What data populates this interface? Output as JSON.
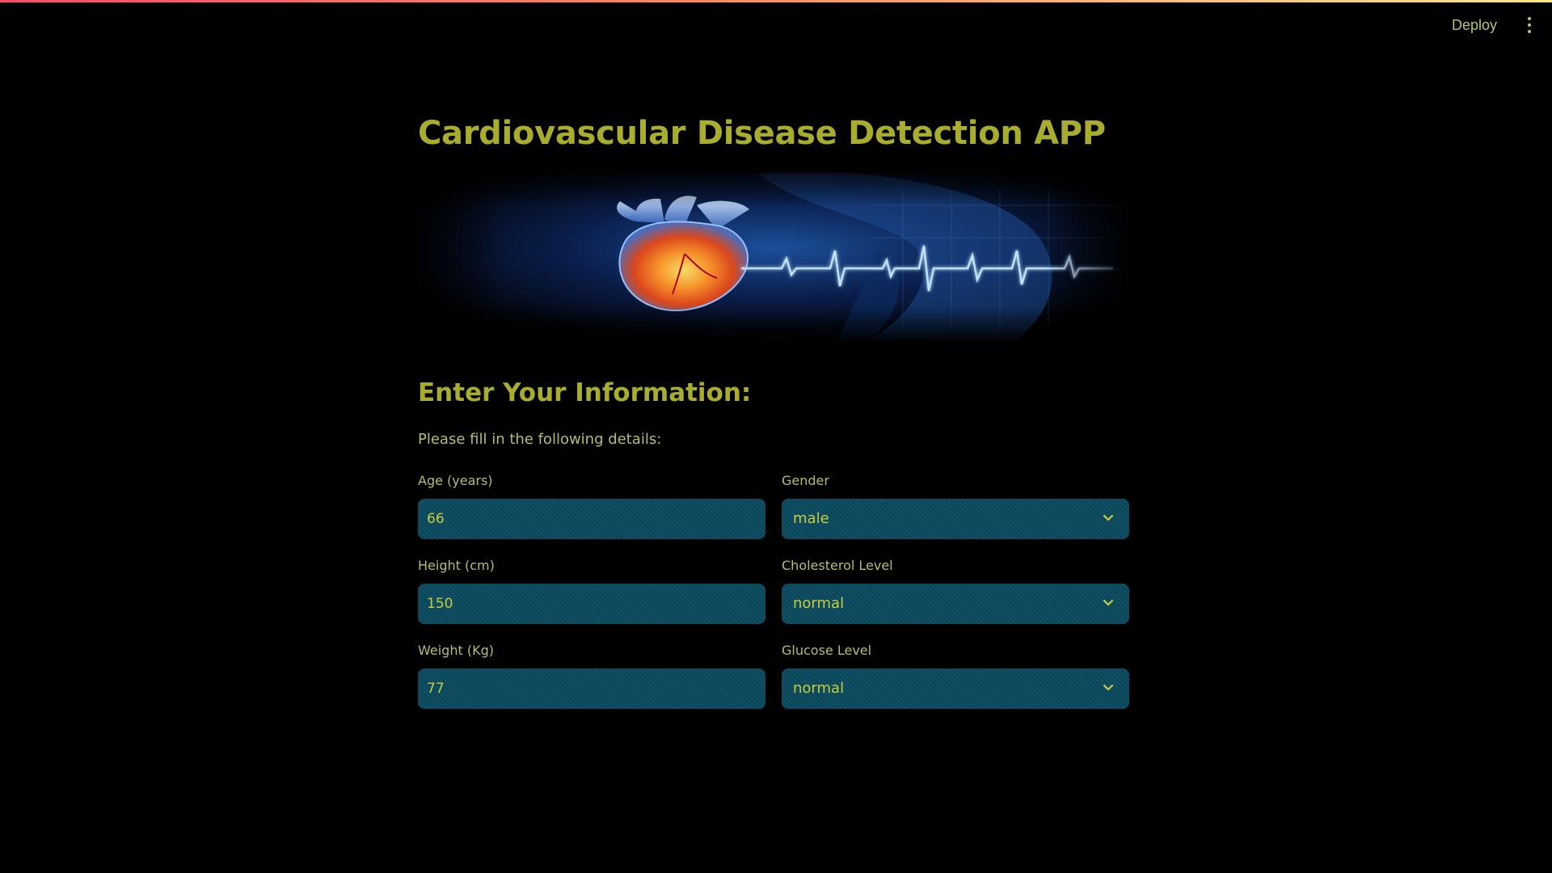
{
  "header": {
    "deploy_label": "Deploy",
    "menu_icon": "kebab-menu-icon"
  },
  "app": {
    "title": "Cardiovascular Disease Detection APP",
    "banner_image": "heart-ekg-banner",
    "subheader": "Enter Your Information:",
    "instructions": "Please fill in the following details:"
  },
  "form": {
    "age": {
      "label": "Age (years)",
      "value": "66"
    },
    "height": {
      "label": "Height (cm)",
      "value": "150"
    },
    "weight": {
      "label": "Weight (Kg)",
      "value": "77"
    },
    "gender": {
      "label": "Gender",
      "value": "male"
    },
    "cholesterol": {
      "label": "Cholesterol Level",
      "value": "normal"
    },
    "glucose": {
      "label": "Glucose Level",
      "value": "normal"
    }
  },
  "colors": {
    "accent": "#a9ad2e",
    "text": "#b8bd6a",
    "field_bg": "#0a4a5e",
    "field_text": "#c7cc3b",
    "background": "#000000"
  }
}
